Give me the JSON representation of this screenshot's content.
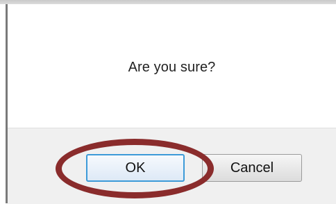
{
  "dialog": {
    "message": "Are you sure?",
    "buttons": {
      "ok_label": "OK",
      "cancel_label": "Cancel"
    }
  },
  "colors": {
    "highlight_ring": "#8a2c2c",
    "ok_focus_border": "#3c9ad8",
    "button_bar_bg": "#f0f0f0"
  }
}
